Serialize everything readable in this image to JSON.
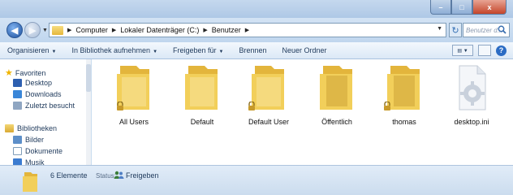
{
  "window": {
    "minimize_label": "–",
    "maximize_label": "□",
    "close_label": "x"
  },
  "address": {
    "crumbs": [
      "Computer",
      "Lokaler Datenträger (C:)",
      "Benutzer"
    ],
    "search_placeholder": "Benutzer d..."
  },
  "toolbar": {
    "organize": "Organisieren",
    "include_library": "In Bibliothek aufnehmen",
    "share_with": "Freigeben für",
    "burn": "Brennen",
    "new_folder": "Neuer Ordner"
  },
  "nav": {
    "favorites": "Favoriten",
    "desktop": "Desktop",
    "downloads": "Downloads",
    "recent": "Zuletzt besucht",
    "libraries": "Bibliotheken",
    "pictures": "Bilder",
    "documents": "Dokumente",
    "music": "Musik"
  },
  "items": [
    {
      "label": "All Users",
      "type": "folder",
      "locked": true
    },
    {
      "label": "Default",
      "type": "folder",
      "locked": false
    },
    {
      "label": "Default User",
      "type": "folder",
      "locked": true
    },
    {
      "label": "Öffentlich",
      "type": "folder",
      "locked": false
    },
    {
      "label": "thomas",
      "type": "folder",
      "locked": true
    },
    {
      "label": "desktop.ini",
      "type": "settings-file",
      "locked": false
    }
  ],
  "status": {
    "count": "6 Elemente",
    "status_label": "Status:",
    "share_state": "Freigeben"
  },
  "colors": {
    "folder_front": "#f2cf5a",
    "folder_back": "#e3b53c",
    "accent": "#1e395b",
    "close_button": "#c4452a"
  }
}
